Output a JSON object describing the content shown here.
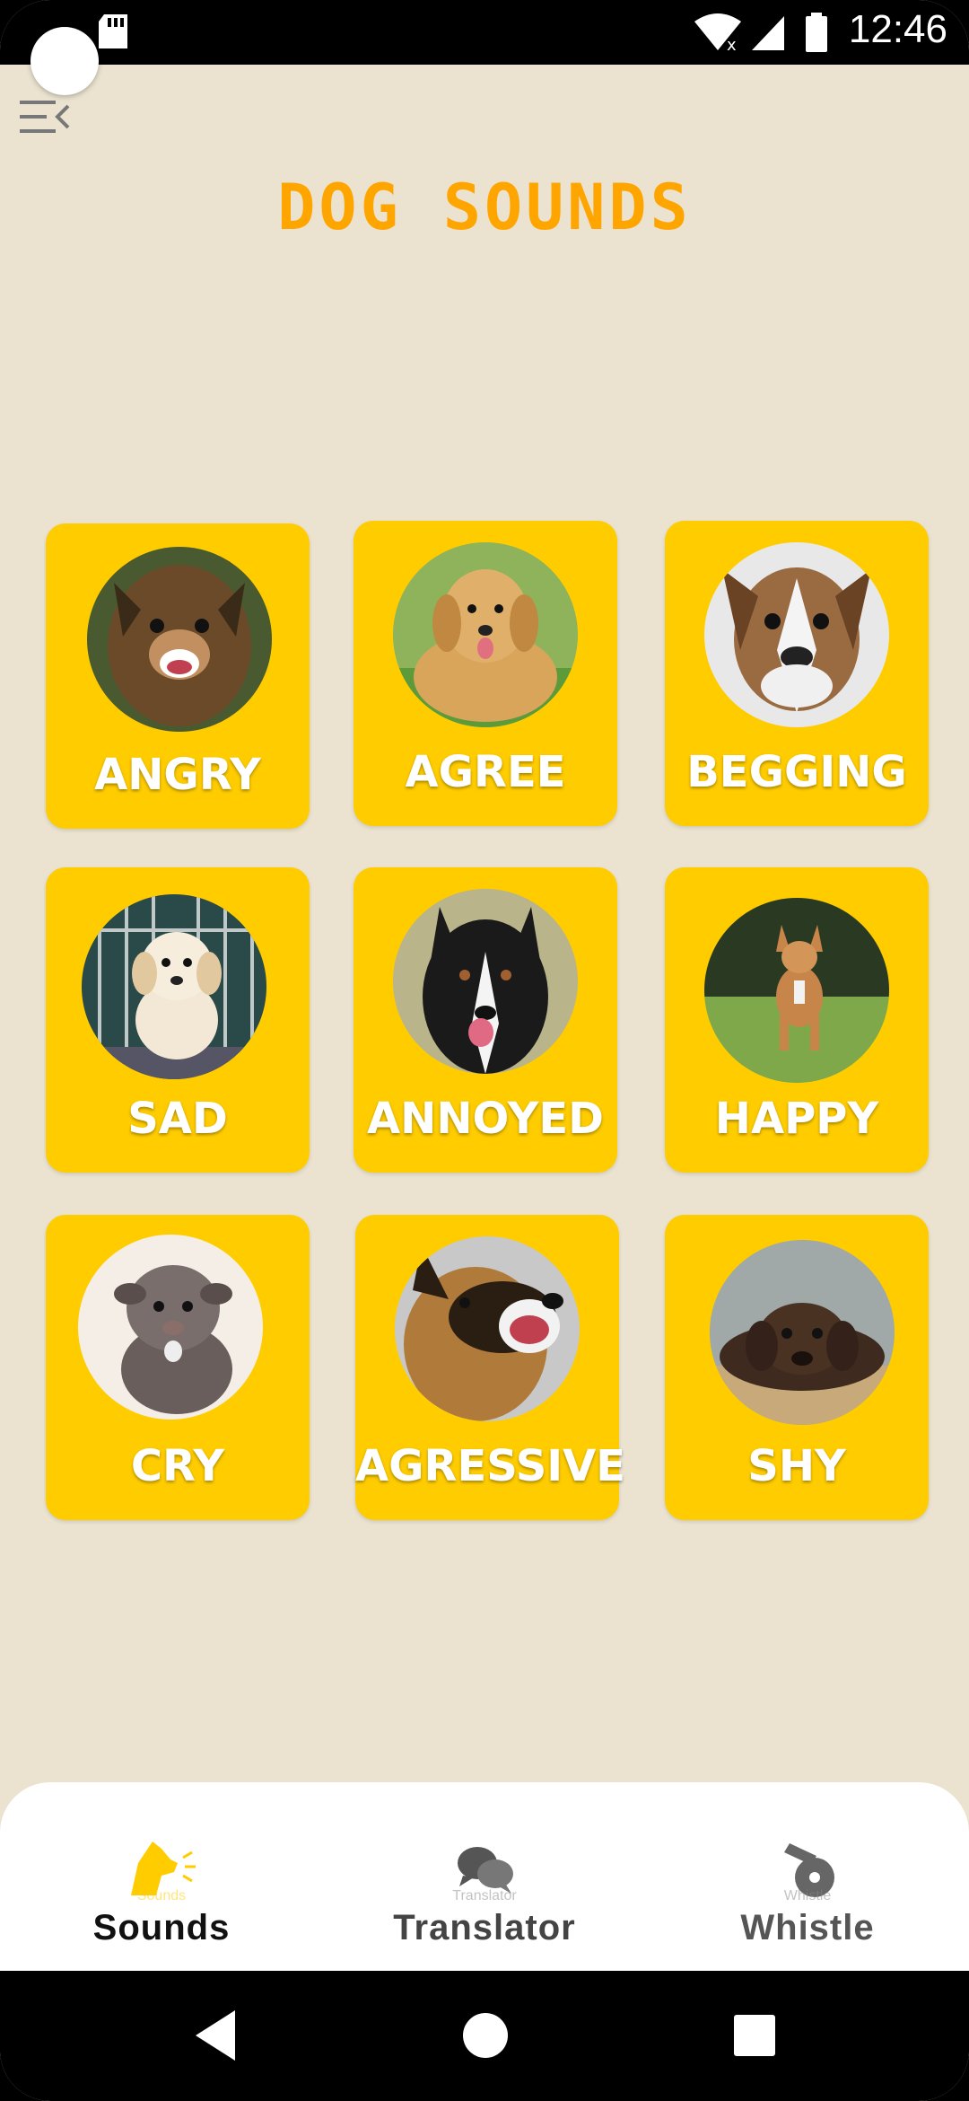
{
  "status_bar": {
    "time": "12:46"
  },
  "header": {
    "title": "DOG  SOUNDS"
  },
  "sounds": [
    {
      "label": "ANGRY",
      "photo": "angry-dog-photo"
    },
    {
      "label": "AGREE",
      "photo": "golden-retriever-photo"
    },
    {
      "label": "BEGGING",
      "photo": "boxer-dog-photo"
    },
    {
      "label": "SAD",
      "photo": "puppy-in-crate-photo"
    },
    {
      "label": "ANNOYED",
      "photo": "border-collie-photo"
    },
    {
      "label": "HAPPY",
      "photo": "running-dog-photo"
    },
    {
      "label": "CRY",
      "photo": "pitbull-puppy-photo"
    },
    {
      "label": "AGRESSIVE",
      "photo": "german-shepherd-photo"
    },
    {
      "label": "SHY",
      "photo": "labrador-photo"
    }
  ],
  "bottom_nav": {
    "sounds": {
      "label": "Sounds",
      "ghost": "Sounds",
      "icon": "dog-barking-icon",
      "active": true
    },
    "translator": {
      "label": "Translator",
      "ghost": "Translator",
      "icon": "chat-bubbles-icon"
    },
    "whistle": {
      "label": "Whistle",
      "ghost": "Whistle",
      "icon": "whistle-icon"
    }
  },
  "colors": {
    "background": "#EBE3D0",
    "card": "#FFCC00",
    "title": "#FFA500",
    "active_icon": "#FFCC00"
  }
}
